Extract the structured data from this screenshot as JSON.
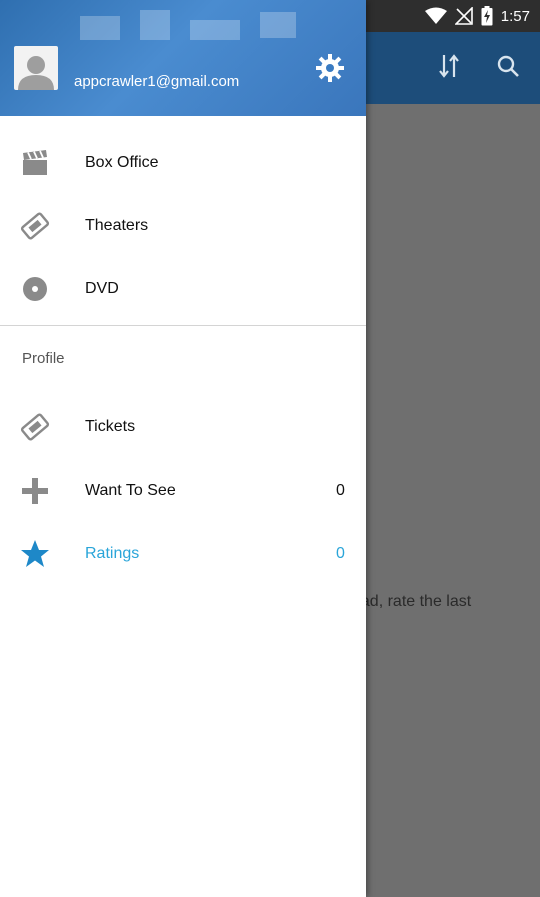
{
  "status_bar": {
    "time": "1:57"
  },
  "background": {
    "hint_text": "ead, rate the last"
  },
  "drawer": {
    "user_email": "appcrawler1@gmail.com",
    "primary_items": [
      {
        "label": "Box Office",
        "icon": "clapperboard-icon"
      },
      {
        "label": "Theaters",
        "icon": "ticket-icon"
      },
      {
        "label": "DVD",
        "icon": "disc-icon"
      }
    ],
    "section_label": "Profile",
    "profile_items": [
      {
        "label": "Tickets",
        "icon": "ticket-icon",
        "count": ""
      },
      {
        "label": "Want To See",
        "icon": "plus-icon",
        "count": "0"
      },
      {
        "label": "Ratings",
        "icon": "star-icon",
        "count": "0"
      }
    ]
  },
  "colors": {
    "accent": "#2aa5d9",
    "header": "#3a7bc2",
    "toolbar": "#1d4d7a",
    "scrim": "#6f6f6f"
  }
}
